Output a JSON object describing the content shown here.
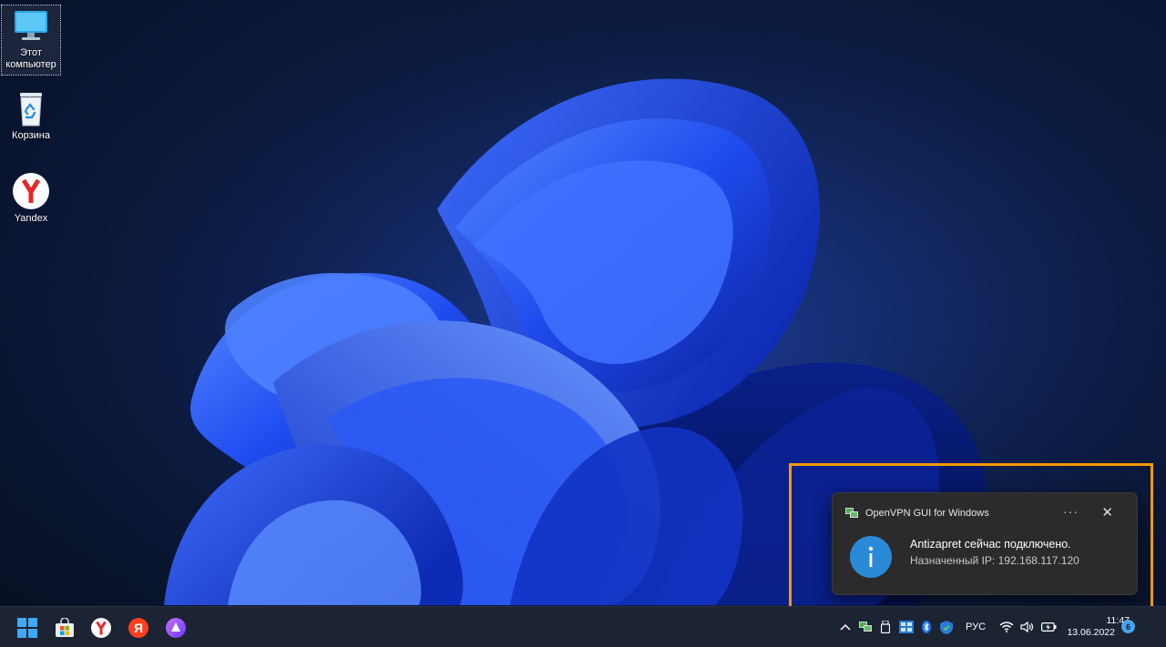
{
  "desktop": {
    "icons": [
      {
        "label": "Этот компьютер",
        "icon": "computer-icon"
      },
      {
        "label": "Корзина",
        "icon": "recycle-bin-icon"
      },
      {
        "label": "Yandex",
        "icon": "yandex-browser-icon"
      }
    ]
  },
  "toast": {
    "app_name": "OpenVPN GUI for Windows",
    "more_label": "···",
    "close_label": "✕",
    "title": "Antizapret сейчас подключено.",
    "body": "Назначенный IP: 192.168.117.120",
    "icon": "info-icon",
    "highlight_color": "#ff9a00"
  },
  "taskbar": {
    "apps": [
      {
        "name": "start",
        "icon": "windows-start-icon"
      },
      {
        "name": "store",
        "icon": "microsoft-store-icon"
      },
      {
        "name": "yandex-browser",
        "icon": "yandex-browser-icon"
      },
      {
        "name": "yandex",
        "icon": "yandex-icon",
        "label": "Я"
      },
      {
        "name": "alice",
        "icon": "alice-icon"
      }
    ],
    "tray": {
      "language": "РУС",
      "time": "11:47",
      "date": "13.06.2022",
      "notification_count": "6"
    }
  }
}
